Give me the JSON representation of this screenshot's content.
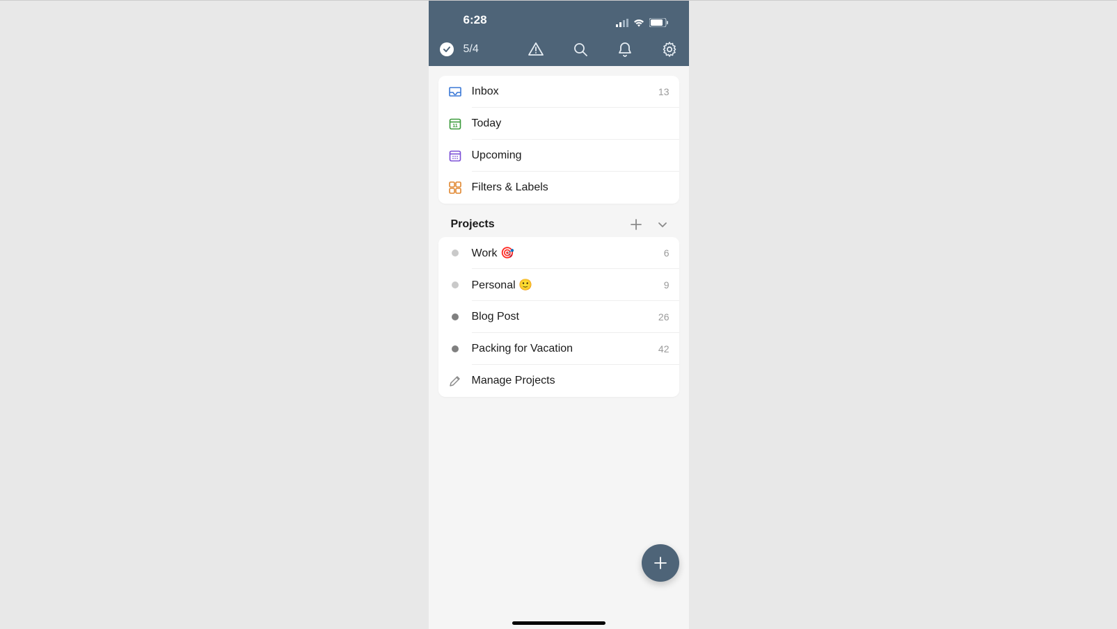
{
  "status": {
    "time": "6:28"
  },
  "toolbar": {
    "task_count": "5/4"
  },
  "nav_items": [
    {
      "label": "Inbox",
      "count": "13"
    },
    {
      "label": "Today",
      "count": ""
    },
    {
      "label": "Upcoming",
      "count": ""
    },
    {
      "label": "Filters & Labels",
      "count": ""
    }
  ],
  "projects_header": {
    "title": "Projects"
  },
  "projects": [
    {
      "label": "Work 🎯",
      "count": "6",
      "dot": "light"
    },
    {
      "label": "Personal 🙂",
      "count": "9",
      "dot": "light"
    },
    {
      "label": "Blog Post",
      "count": "26",
      "dot": "dark"
    },
    {
      "label": "Packing for Vacation",
      "count": "42",
      "dot": "dark"
    }
  ],
  "manage_label": "Manage Projects",
  "colors": {
    "header": "#4e6478",
    "inbox": "#3a78d6",
    "today": "#3a9a3a",
    "upcoming": "#7a4dd6",
    "filters": "#e0862e"
  }
}
